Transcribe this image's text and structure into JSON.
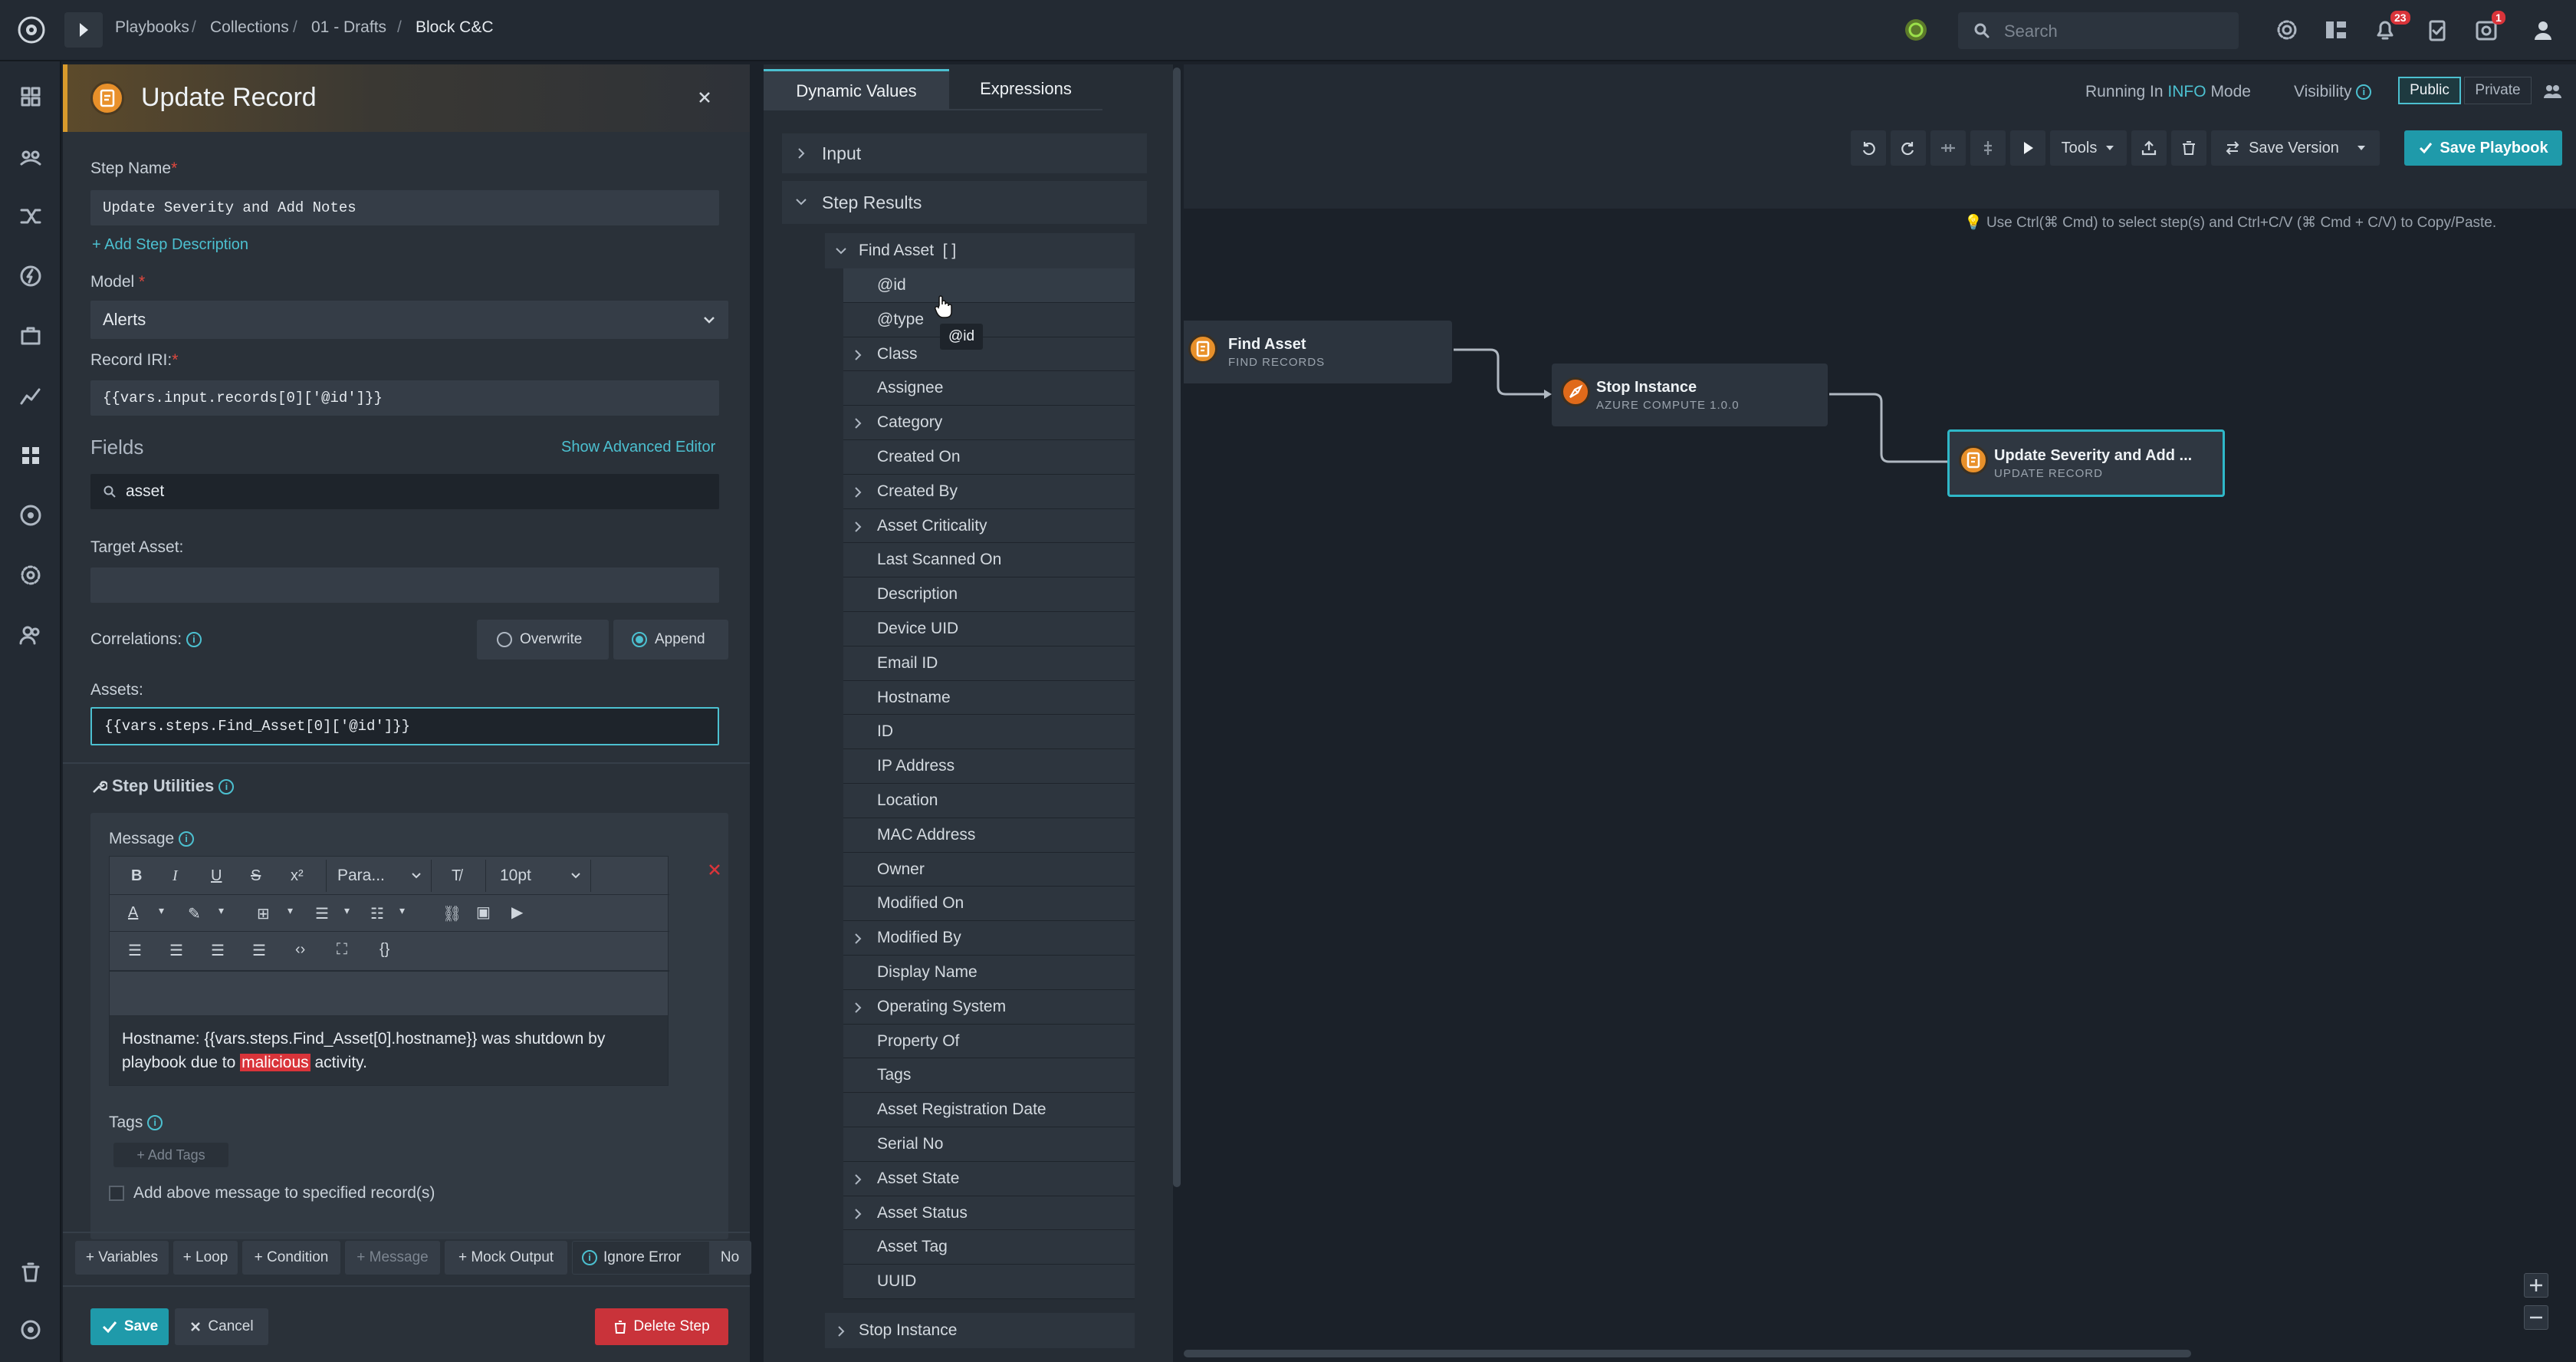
{
  "topbar": {
    "breadcrumbs": [
      "Playbooks",
      "Collections",
      "01 - Drafts",
      "Block C&C"
    ],
    "search_placeholder": "Search",
    "notifications_count": "23",
    "tasks_count": "1"
  },
  "panel": {
    "title": "Update Record",
    "step_name_label": "Step Name",
    "step_name_value": "Update Severity and Add Notes",
    "add_description": "+ Add Step Description",
    "model_label": "Model",
    "model_value": "Alerts",
    "record_iri_label": "Record IRI:",
    "record_iri_value": "{{vars.input.records[0]['@id']}}",
    "fields_heading": "Fields",
    "advanced_editor": "Show Advanced Editor",
    "field_search_value": "asset",
    "target_asset_label": "Target Asset:",
    "correlations_label": "Correlations:",
    "overwrite_label": "Overwrite",
    "append_label": "Append",
    "assets_label": "Assets:",
    "assets_value": "{{vars.steps.Find_Asset[0]['@id']}}",
    "step_utilities": "Step Utilities",
    "message_label": "Message",
    "paragraph_select": "Para...",
    "font_size_select": "10pt",
    "message_text_1": "Hostname: {{vars.steps.Find_Asset[0].hostname}} was shutdown by",
    "message_text_2_pre": "playbook due to ",
    "message_text_2_hl": "malicious",
    "message_text_2_post": " activity.",
    "tags_label": "Tags",
    "add_tags": "+ Add Tags",
    "add_message_checkbox": "Add above message to specified record(s)",
    "footer_buttons": [
      "+ Variables",
      "+ Loop",
      "+ Condition",
      "+ Message",
      "+ Mock Output"
    ],
    "ignore_error": "Ignore Error",
    "ignore_error_value": "No",
    "save": "Save",
    "cancel": "Cancel",
    "delete_step": "Delete Step"
  },
  "dynamic_values": {
    "tabs": [
      "Dynamic Values",
      "Expressions"
    ],
    "input": "Input",
    "step_results": "Step Results",
    "find_asset": "Find Asset  [ ]",
    "tooltip": "@id",
    "items": [
      {
        "label": "@id",
        "expandable": false
      },
      {
        "label": "@type",
        "expandable": false
      },
      {
        "label": "Class",
        "expandable": true
      },
      {
        "label": "Assignee",
        "expandable": false
      },
      {
        "label": "Category",
        "expandable": true
      },
      {
        "label": "Created On",
        "expandable": false
      },
      {
        "label": "Created By",
        "expandable": true
      },
      {
        "label": "Asset Criticality",
        "expandable": true
      },
      {
        "label": "Last Scanned On",
        "expandable": false
      },
      {
        "label": "Description",
        "expandable": false
      },
      {
        "label": "Device UID",
        "expandable": false
      },
      {
        "label": "Email ID",
        "expandable": false
      },
      {
        "label": "Hostname",
        "expandable": false
      },
      {
        "label": "ID",
        "expandable": false
      },
      {
        "label": "IP Address",
        "expandable": false
      },
      {
        "label": "Location",
        "expandable": false
      },
      {
        "label": "MAC Address",
        "expandable": false
      },
      {
        "label": "Owner",
        "expandable": false
      },
      {
        "label": "Modified On",
        "expandable": false
      },
      {
        "label": "Modified By",
        "expandable": true
      },
      {
        "label": "Display Name",
        "expandable": false
      },
      {
        "label": "Operating System",
        "expandable": true
      },
      {
        "label": "Property Of",
        "expandable": false
      },
      {
        "label": "Tags",
        "expandable": false
      },
      {
        "label": "Asset Registration Date",
        "expandable": false
      },
      {
        "label": "Serial No",
        "expandable": false
      },
      {
        "label": "Asset State",
        "expandable": true
      },
      {
        "label": "Asset Status",
        "expandable": true
      },
      {
        "label": "Asset Tag",
        "expandable": false
      },
      {
        "label": "UUID",
        "expandable": false
      }
    ],
    "stop_instance": "Stop Instance"
  },
  "canvas": {
    "running_in": "Running In",
    "mode_level": "INFO",
    "mode": "Mode",
    "visibility": "Visibility",
    "public": "Public",
    "private": "Private",
    "tools": "Tools",
    "save_version": "Save Version",
    "save_playbook": "Save Playbook",
    "hint": "Use Ctrl(⌘ Cmd) to select step(s) and Ctrl+C/V (⌘ Cmd + C/V) to Copy/Paste.",
    "nodes": [
      {
        "title": "Find Asset",
        "subtitle": "FIND RECORDS"
      },
      {
        "title": "Stop Instance",
        "subtitle": "AZURE COMPUTE 1.0.0"
      },
      {
        "title": "Update Severity and Add ...",
        "subtitle": "UPDATE RECORD"
      }
    ]
  }
}
